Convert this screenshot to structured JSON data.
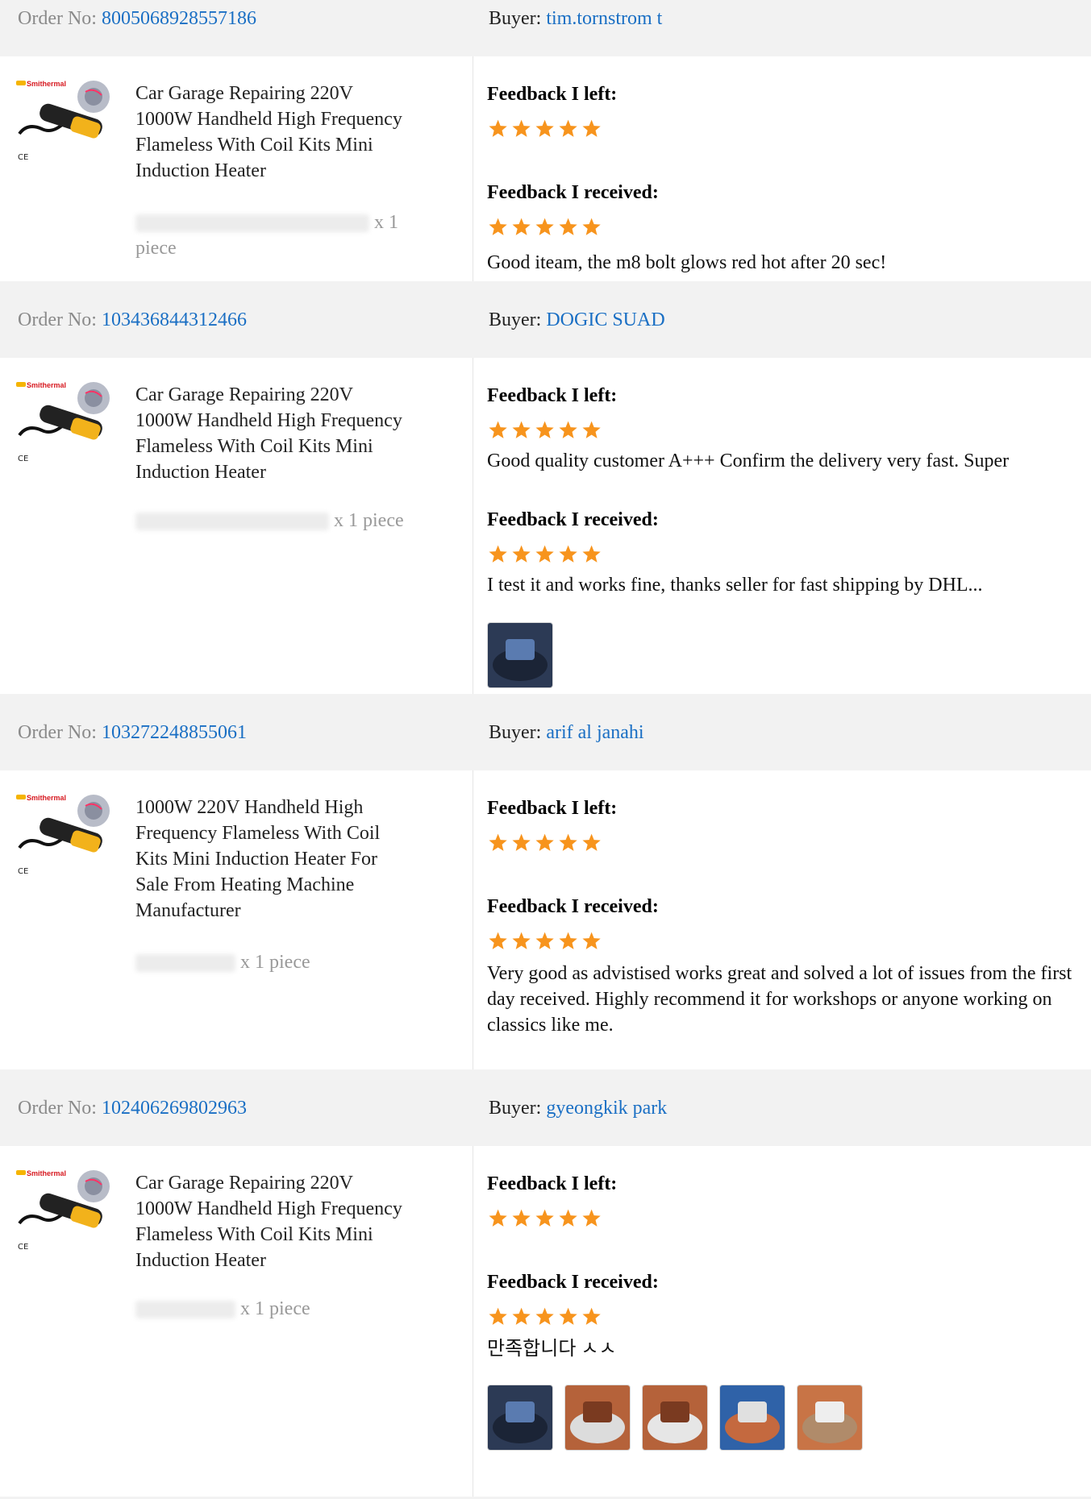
{
  "orders": [
    {
      "order_label": "Order No:",
      "order_no": "8005068928557186",
      "buyer_label": "Buyer:",
      "buyer": "tim.tornstrom t",
      "product_brand": "Smithermal",
      "product_title": "Car Garage Repairing 220V 1000W Handheld High Frequency Flameless With Coil Kits Mini Induction Heater",
      "quantity": "x 1 piece",
      "feedback_left_label": "Feedback I left:",
      "feedback_left_rating": 5,
      "feedback_left_text": "",
      "feedback_received_label": "Feedback I received:",
      "feedback_received_rating": 5,
      "feedback_received_text": "Good iteam, the m8 bolt glows red hot after 20 sec!",
      "photos": []
    },
    {
      "order_label": "Order No:",
      "order_no": "103436844312466",
      "buyer_label": "Buyer:",
      "buyer": "DOGIC SUAD",
      "product_brand": "Smithermal",
      "product_title": "Car Garage Repairing 220V 1000W Handheld High Frequency Flameless With Coil Kits Mini Induction Heater",
      "quantity": "x 1 piece",
      "feedback_left_label": "Feedback I left:",
      "feedback_left_rating": 5,
      "feedback_left_text": "Good quality customer A+++ Confirm the delivery very fast. Super",
      "feedback_received_label": "Feedback I received:",
      "feedback_received_rating": 5,
      "feedback_received_text": "I test it and works fine, thanks seller for fast shipping by DHL...",
      "photos": [
        "case-photo"
      ]
    },
    {
      "order_label": "Order No:",
      "order_no": "103272248855061",
      "buyer_label": "Buyer:",
      "buyer": "arif al janahi",
      "product_brand": "Smithermal",
      "product_title": "1000W 220V Handheld High Frequency Flameless With Coil Kits Mini Induction Heater For Sale From Heating Machine Manufacturer",
      "quantity": "x 1 piece",
      "feedback_left_label": "Feedback I left:",
      "feedback_left_rating": 5,
      "feedback_left_text": "",
      "feedback_received_label": "Feedback I received:",
      "feedback_received_rating": 5,
      "feedback_received_text": "Very good as advistised works great and solved a lot of issues from the first day received. Highly recommend it for workshops or anyone working on classics like me.",
      "photos": []
    },
    {
      "order_label": "Order No:",
      "order_no": "102406269802963",
      "buyer_label": "Buyer:",
      "buyer": "gyeongkik park",
      "product_brand": "Smithermal",
      "product_title": "Car Garage Repairing 220V 1000W Handheld High Frequency Flameless With Coil Kits Mini Induction Heater",
      "quantity": "x 1 piece",
      "feedback_left_label": "Feedback I left:",
      "feedback_left_rating": 5,
      "feedback_left_text": "",
      "feedback_received_label": "Feedback I received:",
      "feedback_received_rating": 5,
      "feedback_received_text": "만족합니다 ㅅㅅ",
      "photos": [
        "case-photo",
        "pliers-photo-1",
        "pliers-photo-2",
        "pliers-photo-3",
        "package-photo"
      ]
    }
  ],
  "colors": {
    "header_bg": "#f2f2f2",
    "link": "#1a6fc4",
    "star": "#f7941d",
    "label_gray": "#8a8a8a"
  }
}
